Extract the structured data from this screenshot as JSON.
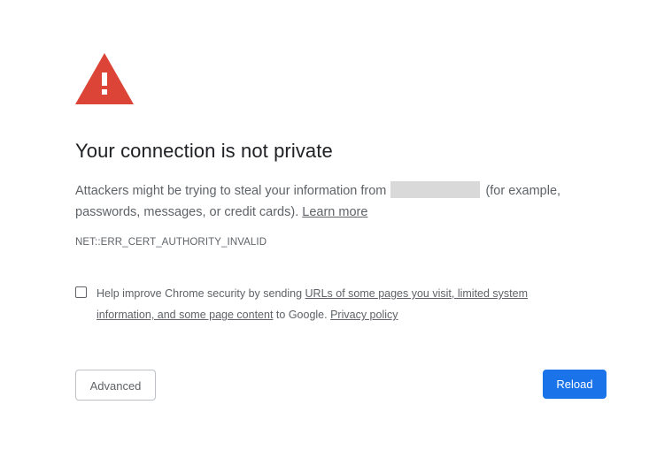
{
  "warning": {
    "icon": "warning-triangle-icon",
    "color": "#db4437"
  },
  "title": "Your connection is not private",
  "body": {
    "text_before": "Attackers might be trying to steal your information from",
    "text_after": "(for example, passwords, messages, or credit cards).",
    "learn_more": "Learn more"
  },
  "error_code": "NET::ERR_CERT_AUTHORITY_INVALID",
  "optin": {
    "checked": false,
    "prefix": "Help improve Chrome security by sending",
    "link_text": "URLs of some pages you visit, limited system information, and some page content",
    "middle": "to Google.",
    "privacy_link": "Privacy policy"
  },
  "buttons": {
    "advanced": "Advanced",
    "reload": "Reload"
  },
  "colors": {
    "primary": "#1a73e8",
    "text": "#202124",
    "secondary_text": "#5f6368"
  }
}
